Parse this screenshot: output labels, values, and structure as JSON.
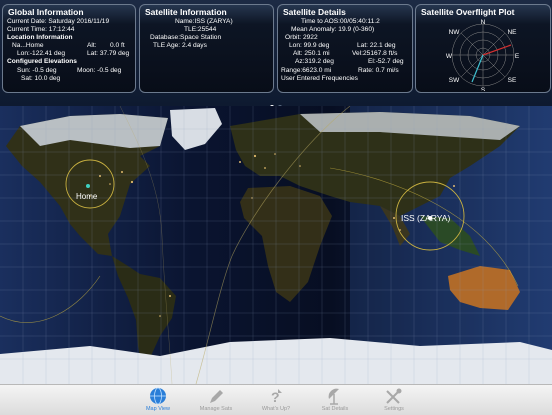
{
  "global_info": {
    "title": "Global Information",
    "current_date": "Current Date: Saturday 2016/11/19",
    "current_time": "Current Time: 17:12:44",
    "location_header": "Location Information",
    "na_label": "Na...Home",
    "alt_label": "Alt:",
    "alt_value": "0.0 ft",
    "lon": "Lon:-122.41 deg",
    "lat": "Lat: 37.79 deg",
    "elevations_header": "Configured Elevations",
    "sun": "Sun: -0.5 deg",
    "moon": "Moon: -0.5 deg",
    "sat": "Sat: 10.0 deg"
  },
  "satellite_info": {
    "title": "Satellite Information",
    "name": "Name:ISS (ZARYA)",
    "tle": "TLE:25544",
    "database": "Database:Space Station",
    "tle_age": "TLE Age: 2.4 days"
  },
  "satellite_details": {
    "title": "Satellite Details",
    "time_to_aos": "Time to AOS:00/05:40:11.2",
    "mean_anomaly": "Mean Anomaly: 19.9 (0-360)",
    "orbit": "Orbit:  2922",
    "lon": "Lon:  99.9 deg",
    "lat": "Lat: 22.1 deg",
    "alt": "Alt: 250.1 mi",
    "vel": "Vel:25167.8 ft/s",
    "az": "Az:319.2 deg",
    "el": "El:-52.7 deg",
    "range": "Range:6623.0 mi",
    "rate": "Rate:   0.7 mi/s",
    "user_freq": "User Entered Frequencies"
  },
  "overflight_plot": {
    "title": "Satellite Overflight Plot",
    "compass": [
      "N",
      "NE",
      "E",
      "SE",
      "S",
      "SW",
      "W",
      "NW"
    ]
  },
  "map": {
    "home_label": "Home",
    "iss_label": "ISS (ZARYA)"
  },
  "page_dots": {
    "count": 2,
    "active": 0
  },
  "tabs": [
    {
      "label": "Map View"
    },
    {
      "label": "Manage Sats"
    },
    {
      "label": "What's Up?"
    },
    {
      "label": "Sat Details"
    },
    {
      "label": "Settings"
    }
  ],
  "colors": {
    "tab_active": "#2a7ed8",
    "tab_inactive": "#9a9a9a",
    "footprint": "#c8b040",
    "home_marker": "#3fd0c0"
  }
}
